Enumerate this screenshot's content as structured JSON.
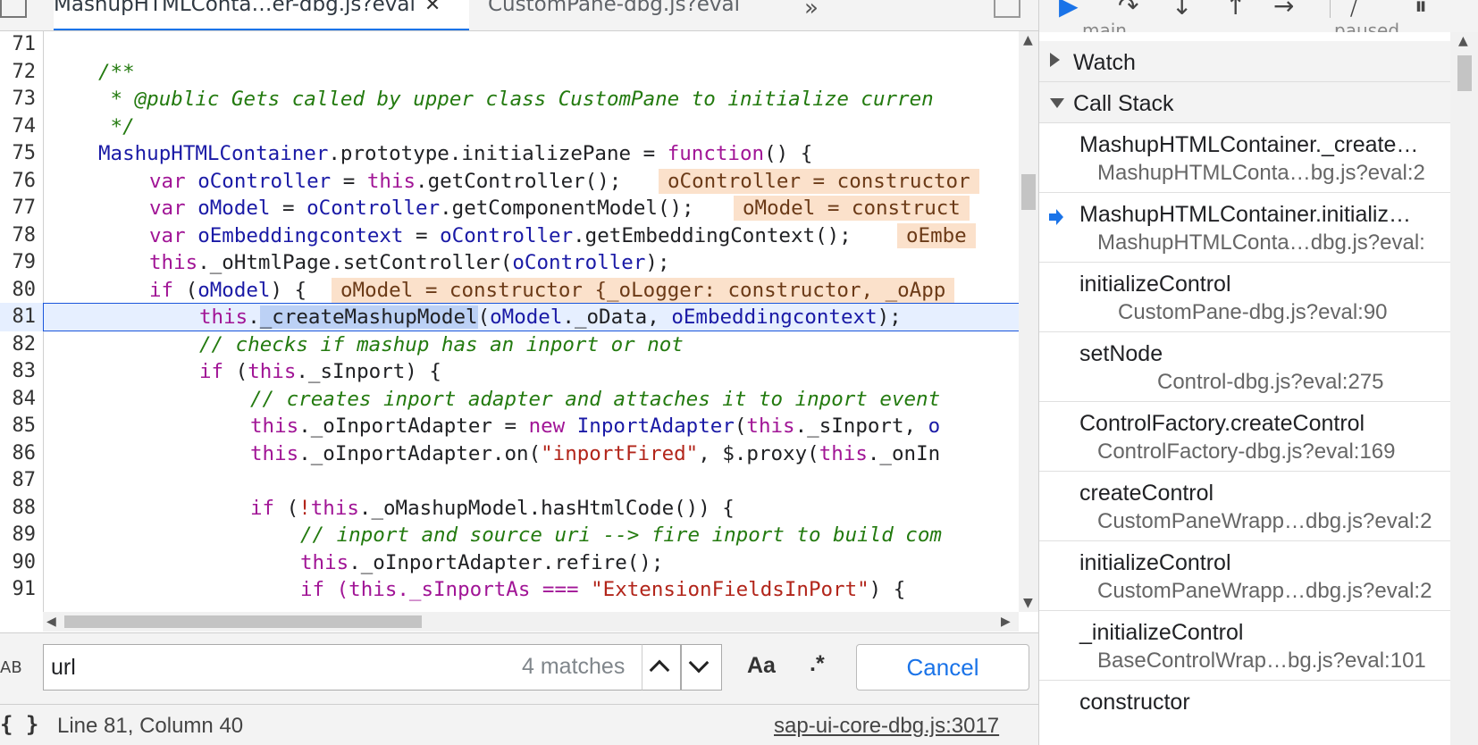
{
  "editor": {
    "tabs": [
      {
        "label": "MashupHTMLConta…er-dbg.js?eval",
        "closable": true
      },
      {
        "label": "CustomPane-dbg.js?eval"
      }
    ],
    "tab_close_glyph": "✕",
    "overflow_glyph": "»",
    "line_numbers": [
      "71",
      "72",
      "73",
      "74",
      "75",
      "76",
      "77",
      "78",
      "79",
      "80",
      "81",
      "82",
      "83",
      "84",
      "85",
      "86",
      "87",
      "88",
      "89",
      "90",
      "91"
    ],
    "inline_values": {
      "l76": "oController = constructor",
      "l77": "oModel = construct",
      "l78": "oEmbe",
      "l80": "oModel = constructor {_oLogger: constructor, _oApp"
    },
    "text": {
      "l72": "/**",
      "l73": " * @public Gets called by upper class CustomPane to initialize curren",
      "l74": " */",
      "l75a": "MashupHTMLContainer",
      "l75b": ".prototype.initializePane = ",
      "l75c": "function",
      "l75d": "() {",
      "l76a": "var ",
      "l76b": "oController",
      "l76c": " = ",
      "l76d": "this",
      "l76e": ".getController();",
      "l77a": "var ",
      "l77b": "oModel",
      "l77c": " = ",
      "l77d": "oController",
      "l77e": ".getComponentModel();",
      "l78a": "var ",
      "l78b": "oEmbeddingcontext",
      "l78c": " = ",
      "l78d": "oController",
      "l78e": ".getEmbeddingContext();",
      "l79a": "this",
      "l79b": "._oHtmlPage.setController(",
      "l79c": "oController",
      "l79d": ");",
      "l80a": "if",
      "l80b": " (",
      "l80c": "oModel",
      "l80d": ") {",
      "l81a": "this",
      "l81b": ".",
      "l81c": "_createMashupModel",
      "l81d": "(",
      "l81e": "oModel",
      "l81f": "._oData, ",
      "l81g": "oEmbeddingcontext",
      "l81h": ");",
      "l82": "// checks if mashup has an inport or not",
      "l83a": "if",
      "l83b": " (",
      "l83c": "this",
      "l83d": "._sInport) {",
      "l84": "// creates inport adapter and attaches it to inport event",
      "l85a": "this",
      "l85b": "._oInportAdapter = ",
      "l85c": "new ",
      "l85d": "InportAdapter",
      "l85e": "(",
      "l85f": "this",
      "l85g": "._sInport, ",
      "l85h": "o",
      "l86a": "this",
      "l86b": "._oInportAdapter.on(",
      "l86c": "\"inportFired\"",
      "l86d": ", $.proxy(",
      "l86e": "this",
      "l86f": "._onIn",
      "l88a": "if",
      "l88b": " (",
      "l88c": "!",
      "l88d": "this",
      "l88e": "._oMashupModel.hasHtmlCode()) {",
      "l89": "// inport and source uri --> fire inport to build com",
      "l90a": "this",
      "l90b": "._oInportAdapter.refire();",
      "l91a": "if (this._sInportAs === ",
      "l91b": "\"ExtensionFieldsInPort\"",
      "l91c": ") {"
    }
  },
  "search": {
    "value": "url",
    "match_count": "4 matches",
    "case_label": "Aa",
    "regex_label": ".*",
    "cancel_label": "Cancel",
    "icon_label": "AB"
  },
  "status": {
    "pretty_print": "{ }",
    "cursor": "Line 81, Column 40",
    "source_link": "sap-ui-core-dbg.js:3017"
  },
  "debugger": {
    "toolbar_peek": {
      "left": "main",
      "right": "paused"
    },
    "sections": {
      "watch": "Watch",
      "call_stack": "Call Stack"
    },
    "call_stack": [
      {
        "fn": "MashupHTMLContainer._create…",
        "loc": "MashupHTMLConta…bg.js?eval:2",
        "indent": 65
      },
      {
        "fn": "MashupHTMLContainer.initializ…",
        "loc": "MashupHTMLConta…dbg.js?eval:",
        "indent": 65,
        "current": true
      },
      {
        "fn": "initializeControl",
        "loc": "CustomPane-dbg.js?eval:90",
        "indent": 88
      },
      {
        "fn": "setNode",
        "loc": "Control-dbg.js?eval:275",
        "indent": 132
      },
      {
        "fn": "ControlFactory.createControl",
        "loc": "ControlFactory-dbg.js?eval:169",
        "indent": 65
      },
      {
        "fn": "createControl",
        "loc": "CustomPaneWrapp…dbg.js?eval:2",
        "indent": 65
      },
      {
        "fn": "initializeControl",
        "loc": "CustomPaneWrapp…dbg.js?eval:2",
        "indent": 65
      },
      {
        "fn": "_initializeControl",
        "loc": "BaseControlWrap…bg.js?eval:101",
        "indent": 65
      },
      {
        "fn": "constructor",
        "loc": "",
        "indent": 65
      }
    ]
  },
  "colors": {
    "accent": "#1a73e8",
    "keyword": "#a11596",
    "comment": "#237a0f",
    "string": "#b2251a",
    "identifier": "#1a1aa6",
    "inline_value_bg": "#fbe1cb"
  }
}
